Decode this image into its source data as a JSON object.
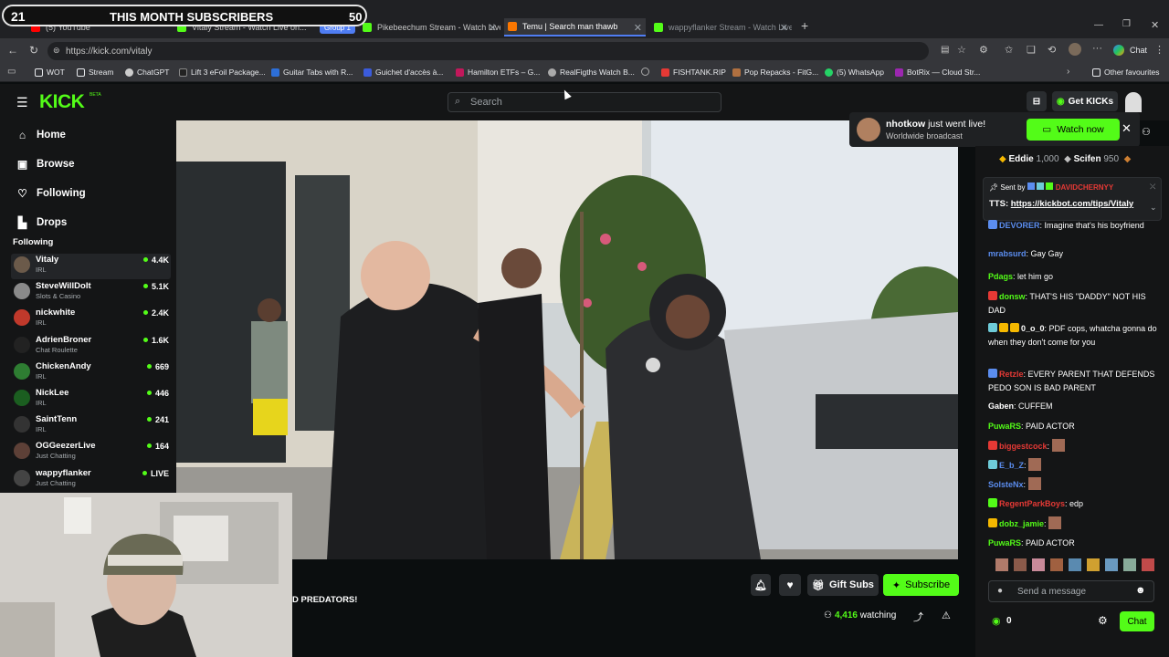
{
  "overlay": {
    "left_number": "21",
    "title": "THIS MONTH SUBSCRIBERS",
    "right_number": "50"
  },
  "browser": {
    "tabs": [
      {
        "label": "(5) YouTube",
        "color": "#ff0000"
      },
      {
        "label": "Vitaly Stream - Watch Live on...",
        "color": "#53fc18"
      },
      {
        "label": "Group 1",
        "color": "#4f7df3"
      },
      {
        "label": "Pikebeechum Stream - Watch Live",
        "color": "#53fc18"
      },
      {
        "label": "Temu | Search man thawb",
        "color": "#fb7701"
      },
      {
        "label": "wappyflanker Stream - Watch Live",
        "color": "#53fc18"
      }
    ],
    "url": "https://kick.com/vitaly",
    "chat_label": "Chat",
    "bookmarks": [
      {
        "label": "WOT",
        "color": "#e8eaed"
      },
      {
        "label": "Stream",
        "color": "#e8eaed"
      },
      {
        "label": "ChatGPT",
        "color": "#cccccc"
      },
      {
        "label": "Lift 3 eFoil Package...",
        "color": "#222222"
      },
      {
        "label": "Guitar Tabs with R...",
        "color": "#2d6fd8"
      },
      {
        "label": "Guichet d'accès à...",
        "color": "#3b5bdb"
      },
      {
        "label": "Hamilton ETFs – G...",
        "color": "#c2185b"
      },
      {
        "label": "RealFigths Watch B...",
        "color": "#aaaaaa"
      },
      {
        "label": "",
        "color": "#aaaaaa"
      },
      {
        "label": "FISHTANK.RIP",
        "color": "#e53935"
      },
      {
        "label": "Pop Repacks - FitG...",
        "color": "#b07040"
      },
      {
        "label": "(5) WhatsApp",
        "color": "#25d366"
      },
      {
        "label": "BotRix — Cloud Str...",
        "color": "#9c27b0"
      }
    ],
    "other_favourites": "Other favourites"
  },
  "kick": {
    "logo": "KICK",
    "beta": "BETA",
    "search_placeholder": "Search",
    "get_kicks": "Get KICKs",
    "nav": [
      {
        "label": "Home",
        "icon": "home-icon"
      },
      {
        "label": "Browse",
        "icon": "browse-icon"
      },
      {
        "label": "Following",
        "icon": "heart-icon"
      },
      {
        "label": "Drops",
        "icon": "drops-icon"
      }
    ],
    "following_header": "Following",
    "channels": [
      {
        "name": "Vitaly",
        "category": "IRL",
        "viewers": "4.4K",
        "color": "#6b5a4a"
      },
      {
        "name": "SteveWillDoIt",
        "category": "Slots & Casino",
        "viewers": "5.1K",
        "color": "#8a8a8a"
      },
      {
        "name": "nickwhite",
        "category": "IRL",
        "viewers": "2.4K",
        "color": "#c0392b"
      },
      {
        "name": "AdrienBroner",
        "category": "Chat Roulette",
        "viewers": "1.6K",
        "color": "#222"
      },
      {
        "name": "ChickenAndy",
        "category": "IRL",
        "viewers": "669",
        "color": "#2e7d32"
      },
      {
        "name": "NickLee",
        "category": "IRL",
        "viewers": "446",
        "color": "#1b5e20"
      },
      {
        "name": "SaintTenn",
        "category": "IRL",
        "viewers": "241",
        "color": "#333"
      },
      {
        "name": "OGGeezerLive",
        "category": "Just Chatting",
        "viewers": "164",
        "color": "#5d4037"
      },
      {
        "name": "wappyflanker",
        "category": "Just Chatting",
        "viewers": "LIVE",
        "color": "#444"
      }
    ],
    "notification": {
      "user": "nhotkow",
      "text": " just went live!",
      "sub": "Worldwide broadcast",
      "button": "Watch now"
    },
    "stream_title_fragment": "D PREDATORS!",
    "gift_subs": "Gift Subs",
    "subscribe": "Subscribe",
    "watching_count": "4,416",
    "watching_label": "watching"
  },
  "chat": {
    "leaderboard": [
      {
        "name": "Eddie",
        "value": "1,000"
      },
      {
        "name": "Scifen",
        "value": "950"
      }
    ],
    "pinned": {
      "sent_by": "Sent by",
      "sender": "DAVIDCHERNYY",
      "tts_label": "TTS:",
      "tts_link": "https://kickbot.com/tips/Vitaly"
    },
    "messages": [
      {
        "user": "DEVORER",
        "color": "#5b8def",
        "text": "Imagine that's his boyfriend"
      },
      {
        "user": "mrabsurd",
        "color": "#5b8def",
        "text": "Gay Gay"
      },
      {
        "user": "Pdags",
        "color": "#53fc18",
        "text": "let him go"
      },
      {
        "user": "donsw",
        "color": "#53fc18",
        "text": "THAT'S HIS \"DADDY\" NOT HIS DAD"
      },
      {
        "user": "0_o_0",
        "color": "#ffffff",
        "text": "PDF cops, whatcha gonna do when they don't come for you"
      },
      {
        "user": "Retzle",
        "color": "#e53935",
        "text": "EVERY PARENT THAT DEFENDS PEDO SON IS BAD PARENT"
      },
      {
        "user": "Gaben",
        "color": "#ffffff",
        "text": "CUFFEM"
      },
      {
        "user": "PuwaRS",
        "color": "#53fc18",
        "text": "PAID ACTOR"
      },
      {
        "user": "biggestcock",
        "color": "#e53935",
        "text": ""
      },
      {
        "user": "E_b_Z",
        "color": "#5b8def",
        "text": ""
      },
      {
        "user": "SolsteNx",
        "color": "#5b8def",
        "text": ""
      },
      {
        "user": "RegentParkBoys",
        "color": "#e53935",
        "text": "edp"
      },
      {
        "user": "dobz_jamie",
        "color": "#53fc18",
        "text": ""
      },
      {
        "user": "PuwaRS",
        "color": "#53fc18",
        "text": "PAID ACTOR"
      }
    ],
    "input_placeholder": "Send a message",
    "kicks_count": "0",
    "chat_button": "Chat"
  }
}
